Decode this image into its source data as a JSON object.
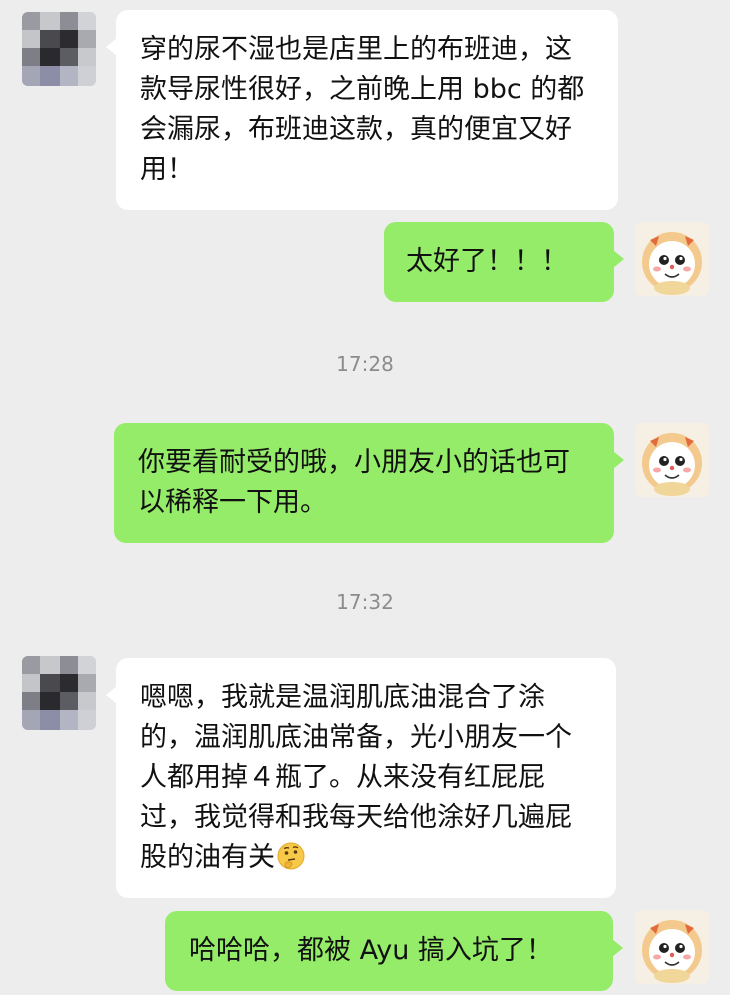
{
  "conversation": {
    "messages": [
      {
        "sender": "other",
        "text": "穿的尿不湿也是店里上的布班迪，这款导尿性很好，之前晚上用 bbc 的都会漏尿，布班迪这款，真的便宜又好用！"
      },
      {
        "sender": "self",
        "text": "太好了！！！"
      },
      {
        "type": "timestamp",
        "text": "17:28"
      },
      {
        "sender": "self",
        "text": "你要看耐受的哦，小朋友小的话也可以稀释一下用。"
      },
      {
        "type": "timestamp",
        "text": "17:32"
      },
      {
        "sender": "other",
        "text": "嗯嗯，我就是温润肌底油混合了涂的，温润肌底油常备，光小朋友一个人都用掉４瓶了。从来没有红屁屁过，我觉得和我每天给他涂好几遍屁股的油有关",
        "emoji": "thinking-face-emoji"
      },
      {
        "sender": "self",
        "text": "哈哈哈，都被 Ayu 搞入坑了！"
      }
    ]
  },
  "colors": {
    "background": "#ededed",
    "self_bubble": "#95ec69",
    "other_bubble": "#ffffff",
    "timestamp_text": "#8c8c8c"
  }
}
